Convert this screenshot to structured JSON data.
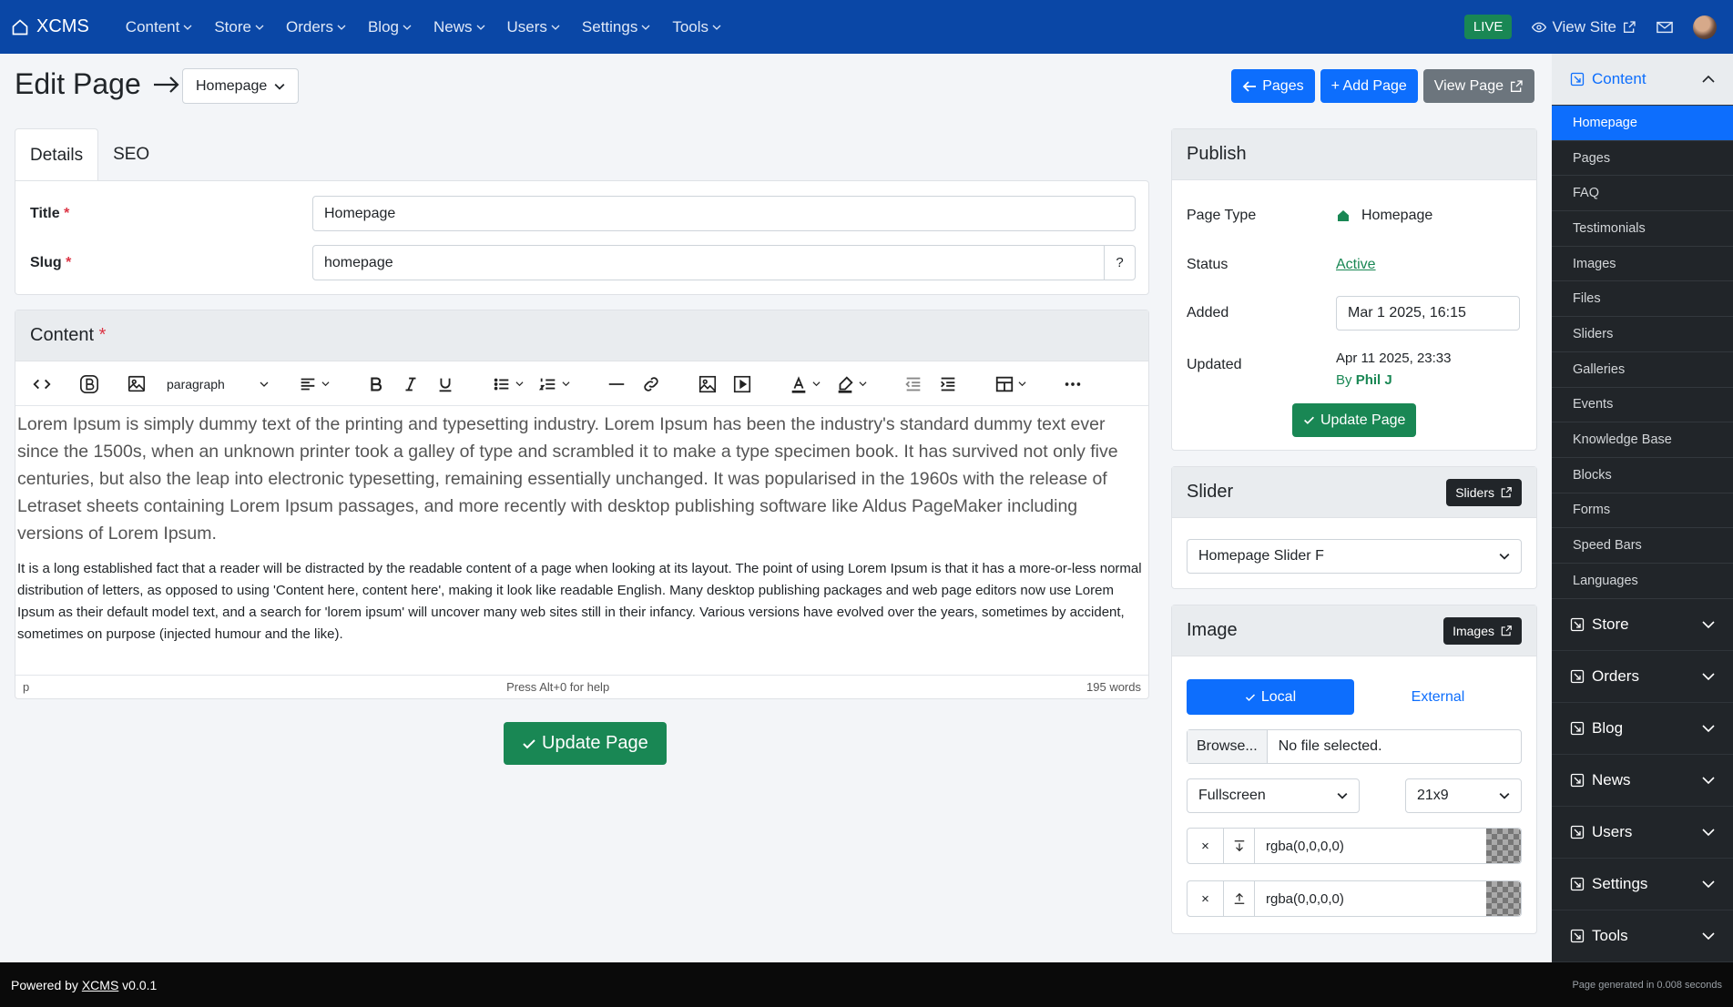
{
  "app": {
    "brand": "XCMS",
    "nav": [
      "Content",
      "Store",
      "Orders",
      "Blog",
      "News",
      "Users",
      "Settings",
      "Tools"
    ],
    "live_badge": "LIVE",
    "view_site": "View Site"
  },
  "page": {
    "title": "Edit Page",
    "selected_page": "Homepage",
    "buttons": {
      "pages": "Pages",
      "add_page": "+ Add Page",
      "view_page": "View Page"
    }
  },
  "tabs": [
    "Details",
    "SEO"
  ],
  "details": {
    "title_label": "Title",
    "title_value": "Homepage",
    "slug_label": "Slug",
    "slug_value": "homepage",
    "slug_help": "?"
  },
  "content": {
    "header": "Content",
    "block_format": "paragraph",
    "lead": "Lorem Ipsum is simply dummy text of the printing and typesetting industry. Lorem Ipsum has been the industry's standard dummy text ever since the 1500s, when an unknown printer took a galley of type and scrambled it to make a type specimen book. It has survived not only five centuries, but also the leap into electronic typesetting, remaining essentially unchanged. It was popularised in the 1960s with the release of Letraset sheets containing Lorem Ipsum passages, and more recently with desktop publishing software like Aldus PageMaker including versions of Lorem Ipsum.",
    "body": "It is a long established fact that a reader will be distracted by the readable content of a page when looking at its layout. The point of using Lorem Ipsum is that it has a more-or-less normal distribution of letters, as opposed to using 'Content here, content here', making it look like readable English. Many desktop publishing packages and web page editors now use Lorem Ipsum as their default model text, and a search for 'lorem ipsum' will uncover many web sites still in their infancy. Various versions have evolved over the years, sometimes by accident, sometimes on purpose (injected humour and the like).",
    "status_path": "p",
    "status_help": "Press Alt+0 for help",
    "status_words": "195 words",
    "update_button": "Update Page"
  },
  "publish": {
    "header": "Publish",
    "page_type_label": "Page Type",
    "page_type_value": "Homepage",
    "status_label": "Status",
    "status_value": "Active",
    "added_label": "Added",
    "added_value": "Mar 1 2025, 16:15",
    "updated_label": "Updated",
    "updated_value": "Apr 11 2025, 23:33",
    "updated_by_prefix": "By",
    "updated_by": "Phil J",
    "update_button": "Update Page"
  },
  "slider": {
    "header": "Slider",
    "button": "Sliders",
    "selected": "Homepage Slider F"
  },
  "image": {
    "header": "Image",
    "button": "Images",
    "local": "Local",
    "external": "External",
    "browse": "Browse...",
    "no_file": "No file selected.",
    "size": "Fullscreen",
    "ratio": "21x9",
    "color1": "rgba(0,0,0,0)",
    "color2": "rgba(0,0,0,0)",
    "clear": "×"
  },
  "sidebar": {
    "content_header": "Content",
    "content_items": [
      "Homepage",
      "Pages",
      "FAQ",
      "Testimonials",
      "Images",
      "Files",
      "Sliders",
      "Galleries",
      "Events",
      "Knowledge Base",
      "Blocks",
      "Forms",
      "Speed Bars",
      "Languages"
    ],
    "groups": [
      "Store",
      "Orders",
      "Blog",
      "News",
      "Users",
      "Settings",
      "Tools"
    ]
  },
  "footer": {
    "powered_by": "Powered by",
    "brand": "XCMS",
    "version": "v0.0.1",
    "generated": "Page generated in 0.008 seconds"
  },
  "colors": {
    "nav": "#0a47a6",
    "primary": "#0d6efd",
    "success": "#198754",
    "sidebar": "#212529"
  }
}
